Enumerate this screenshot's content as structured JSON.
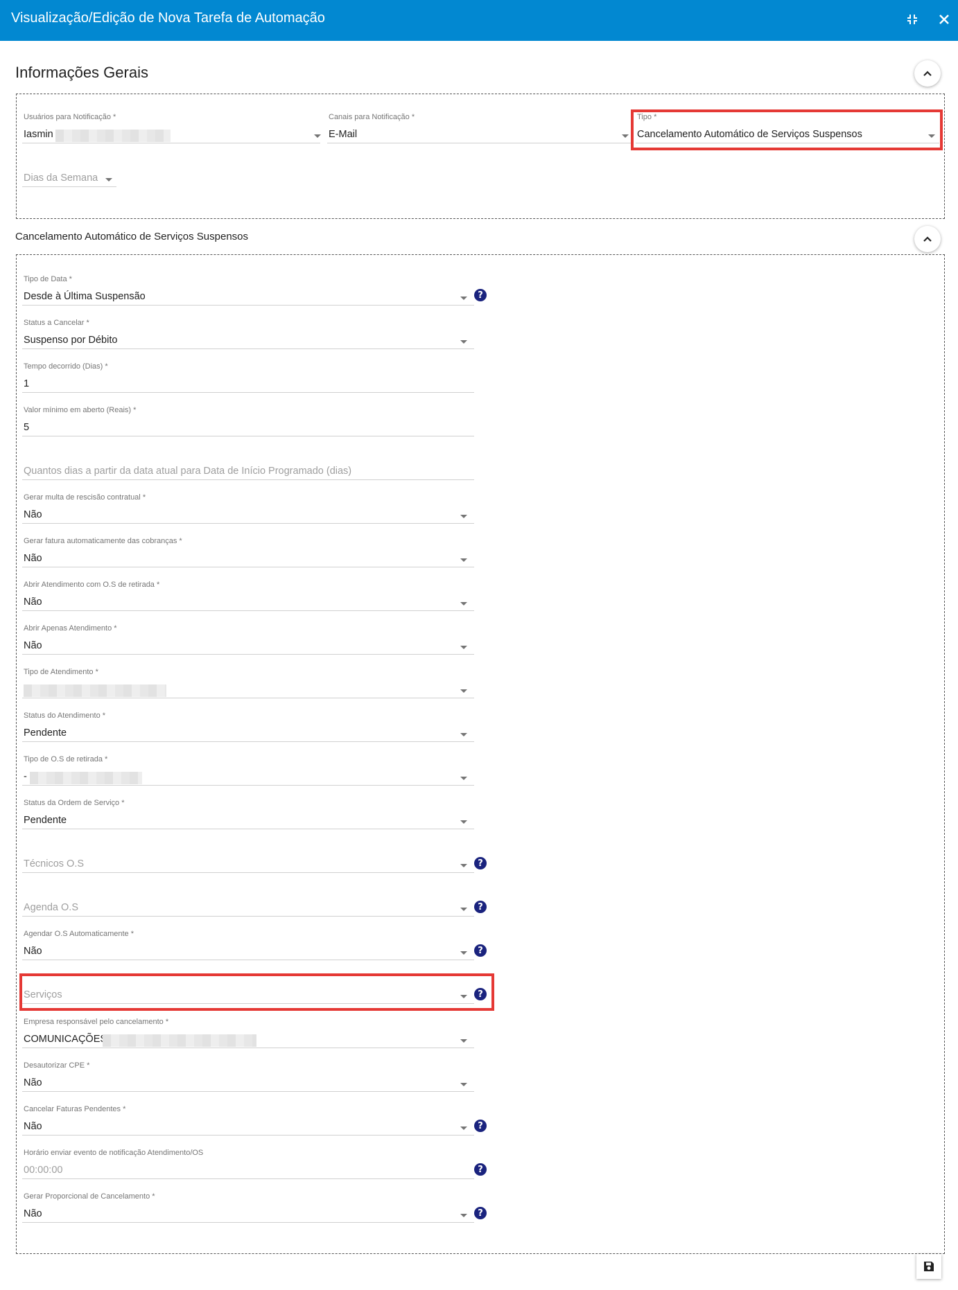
{
  "dialog": {
    "title": "Visualização/Edição de Nova Tarefa de Automação"
  },
  "general": {
    "heading": "Informações Gerais",
    "users_label": "Usuários para Notificação",
    "users_value": "Iasmin",
    "channels_label": "Canais para Notificação",
    "channels_value": "E-Mail",
    "type_label": "Tipo",
    "type_value": "Cancelamento Automático de Serviços Suspensos",
    "weekdays_placeholder": "Dias da Semana"
  },
  "cancel_section": {
    "heading": "Cancelamento Automático de Serviços Suspensos",
    "fields": {
      "date_type": {
        "label": "Tipo de Data",
        "value": "Desde à Última Suspensão"
      },
      "status_cancel": {
        "label": "Status a Cancelar",
        "value": "Suspenso por Débito"
      },
      "elapsed_days": {
        "label": "Tempo decorrido (Dias)",
        "value": "1"
      },
      "min_value": {
        "label": "Valor mínimo em aberto (Reais)",
        "value": "5"
      },
      "start_days": {
        "placeholder": "Quantos dias a partir da data atual para Data de Início Programado (dias)"
      },
      "penalty": {
        "label": "Gerar multa de rescisão contratual",
        "value": "Não"
      },
      "invoice": {
        "label": "Gerar fatura automaticamente das cobranças",
        "value": "Não"
      },
      "open_service_os": {
        "label": "Abrir Atendimento com O.S de retirada",
        "value": "Não"
      },
      "open_service_only": {
        "label": "Abrir Apenas Atendimento",
        "value": "Não"
      },
      "service_type": {
        "label": "Tipo de Atendimento",
        "value": ""
      },
      "service_status": {
        "label": "Status do Atendimento",
        "value": "Pendente"
      },
      "os_type": {
        "label": "Tipo de O.S de retirada",
        "value": "-"
      },
      "os_status": {
        "label": "Status da Ordem de Serviço",
        "value": "Pendente"
      },
      "os_techs": {
        "placeholder": "Técnicos O.S"
      },
      "os_agenda": {
        "placeholder": "Agenda O.S"
      },
      "auto_schedule": {
        "label": "Agendar O.S Automaticamente",
        "value": "Não"
      },
      "services": {
        "placeholder": "Serviços"
      },
      "company": {
        "label": "Empresa responsável pelo cancelamento",
        "value": "COMUNICAÇÕES"
      },
      "deauth_cpe": {
        "label": "Desautorizar CPE",
        "value": "Não"
      },
      "cancel_invoices": {
        "label": "Cancelar Faturas Pendentes",
        "value": "Não"
      },
      "notify_time": {
        "label": "Horário enviar evento de notificação Atendimento/OS",
        "value": "00:00:00"
      },
      "proportional": {
        "label": "Gerar Proporcional de Cancelamento",
        "value": "Não"
      }
    }
  },
  "icons": {
    "minimize": "minimize-icon",
    "close": "close-icon",
    "chevron": "chevron-up-icon",
    "help": "help-icon",
    "save": "save-icon"
  },
  "symbols": {
    "required": "*",
    "help": "?"
  },
  "colors": {
    "header": "#0288d1",
    "highlight": "#e53935",
    "help": "#1a237e"
  }
}
